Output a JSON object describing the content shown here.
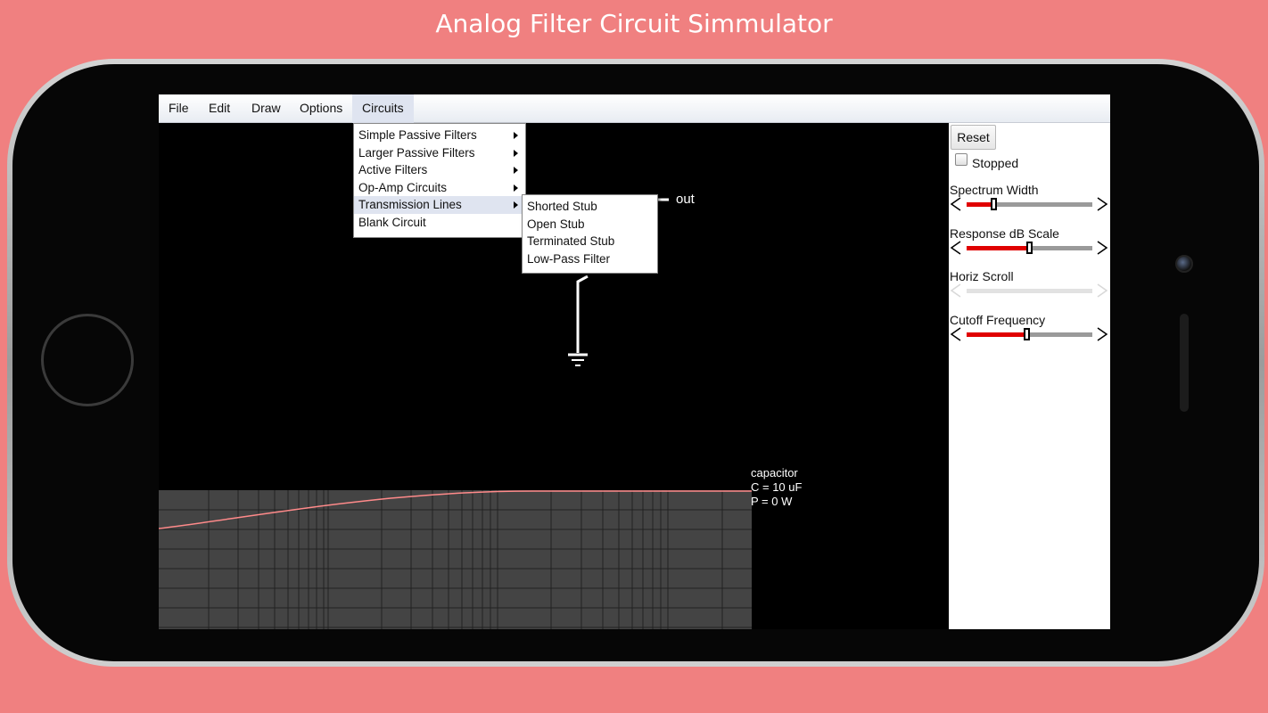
{
  "promo_title": "Analog Filter Circuit Simmulator",
  "menubar": [
    "File",
    "Edit",
    "Draw",
    "Options",
    "Circuits"
  ],
  "active_menu": "Circuits",
  "circuits_menu": {
    "items": [
      {
        "label": "Simple Passive Filters",
        "submenu": true
      },
      {
        "label": "Larger Passive Filters",
        "submenu": true
      },
      {
        "label": "Active Filters",
        "submenu": true
      },
      {
        "label": "Op-Amp Circuits",
        "submenu": true
      },
      {
        "label": "Transmission Lines",
        "submenu": true,
        "selected": true
      },
      {
        "label": "Blank Circuit",
        "submenu": false
      }
    ]
  },
  "transmission_lines_submenu": [
    "Shorted Stub",
    "Open Stub",
    "Terminated Stub",
    "Low-Pass Filter"
  ],
  "circuit": {
    "node_label": "out"
  },
  "side_panel": {
    "reset_label": "Reset",
    "stopped_label": "Stopped",
    "stopped_checked": false,
    "sliders": [
      {
        "label": "Spectrum Width",
        "value": 0.2,
        "enabled": true
      },
      {
        "label": "Response dB Scale",
        "value": 0.5,
        "enabled": true
      },
      {
        "label": "Horiz Scroll",
        "value": 0,
        "enabled": false
      },
      {
        "label": "Cutoff Frequency",
        "value": 0.48,
        "enabled": true
      }
    ]
  },
  "element_info": [
    "capacitor",
    "C = 10 uF",
    "P = 0 W"
  ],
  "colors": {
    "background": "#f08080",
    "response_curve": "#ff8a8a",
    "slider_fill": "#e00000",
    "graph_bg": "#444444"
  }
}
